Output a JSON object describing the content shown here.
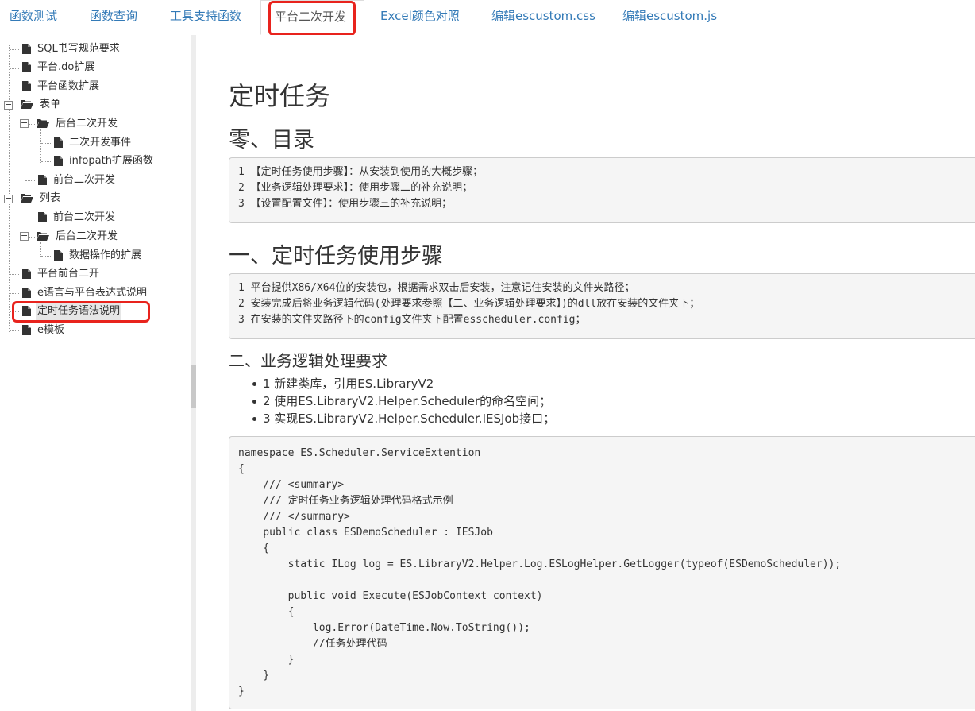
{
  "tabs": [
    {
      "label": "函数测试"
    },
    {
      "label": "函数查询"
    },
    {
      "label": "工具支持函数"
    },
    {
      "label": "平台二次开发",
      "active": true
    },
    {
      "label": "Excel颜色对照"
    },
    {
      "label": "编辑escustom.css"
    },
    {
      "label": "编辑escustom.js"
    }
  ],
  "tree": [
    {
      "label": "SQL书写规范要求",
      "icon": "file-icon"
    },
    {
      "label": "平台.do扩展",
      "icon": "file-icon"
    },
    {
      "label": "平台函数扩展",
      "icon": "file-icon"
    },
    {
      "label": "表单",
      "icon": "folder-open-icon"
    },
    {
      "label": "后台二次开发",
      "icon": "folder-open-icon"
    },
    {
      "label": "二次开发事件",
      "icon": "file-icon"
    },
    {
      "label": "infopath扩展函数",
      "icon": "file-icon"
    },
    {
      "label": "前台二次开发",
      "icon": "file-icon"
    },
    {
      "label": "列表",
      "icon": "folder-open-icon"
    },
    {
      "label": "前台二次开发",
      "icon": "file-icon"
    },
    {
      "label": "后台二次开发",
      "icon": "folder-open-icon"
    },
    {
      "label": "数据操作的扩展",
      "icon": "file-icon"
    },
    {
      "label": "平台前台二开",
      "icon": "file-icon"
    },
    {
      "label": "e语言与平台表达式说明",
      "icon": "file-icon"
    },
    {
      "label": "定时任务语法说明",
      "icon": "file-icon",
      "selected": true
    },
    {
      "label": "e模板",
      "icon": "file-icon"
    }
  ],
  "content": {
    "title": "定时任务",
    "sec0_heading": "零、目录",
    "toc_lines": [
      "1 【定时任务使用步骤】：从安装到使用的大概步骤；",
      "2 【业务逻辑处理要求】：使用步骤二的补充说明；",
      "3 【设置配置文件】：使用步骤三的补充说明；"
    ],
    "sec1_heading": "一、定时任务使用步骤",
    "step_lines": [
      "1 平台提供X86/X64位的安装包，根据需求双击后安装，注意记住安装的文件夹路径；",
      "2 安装完成后将业务逻辑代码(处理要求参照【二、业务逻辑处理要求】)的dll放在安装的文件夹下；",
      "3 在安装的文件夹路径下的config文件夹下配置esscheduler.config；"
    ],
    "sec2_heading": "二、业务逻辑处理要求",
    "bullets": [
      "1 新建类库，引用ES.LibraryV2",
      "2 使用ES.LibraryV2.Helper.Scheduler的命名空间；",
      "3 实现ES.LibraryV2.Helper.Scheduler.IESJob接口；"
    ],
    "code_lines": [
      "namespace ES.Scheduler.ServiceExtention",
      "{",
      "    /// <summary>",
      "    /// 定时任务业务逻辑处理代码格式示例",
      "    /// </summary>",
      "    public class ESDemoScheduler : IESJob",
      "    {",
      "        static ILog log = ES.LibraryV2.Helper.Log.ESLogHelper.GetLogger(typeof(ESDemoScheduler));",
      "",
      "        public void Execute(ESJobContext context)",
      "        {",
      "            log.Error(DateTime.Now.ToString());",
      "            //任务处理代码",
      "        }",
      "    }",
      "}"
    ]
  },
  "colors": {
    "link": "#337ab7",
    "highlight": "#e8231d",
    "code_bg": "#f5f5f5"
  }
}
